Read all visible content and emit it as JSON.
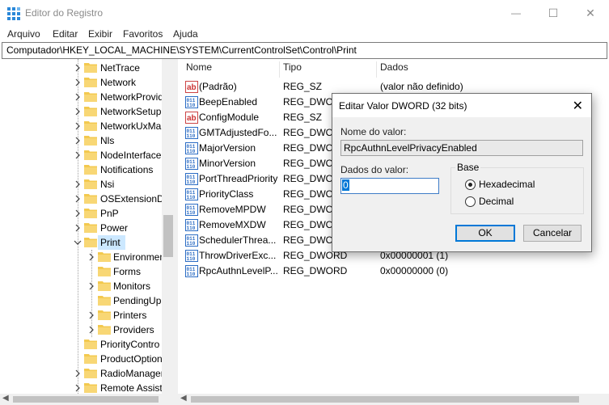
{
  "window": {
    "title": "Editor do Registro",
    "controls": {
      "minimize": "—",
      "maximize": "☐",
      "close": "✕"
    }
  },
  "menu": [
    "Arquivo",
    "Editar",
    "Exibir",
    "Favoritos",
    "Ajuda"
  ],
  "address": "Computador\\HKEY_LOCAL_MACHINE\\SYSTEM\\CurrentControlSet\\Control\\Print",
  "tree": {
    "items": [
      {
        "label": "NetTrace",
        "expandable": true,
        "selected": false
      },
      {
        "label": "Network",
        "expandable": true,
        "selected": false
      },
      {
        "label": "NetworkProvid",
        "expandable": true,
        "selected": false
      },
      {
        "label": "NetworkSetup",
        "expandable": true,
        "selected": false
      },
      {
        "label": "NetworkUxMa",
        "expandable": true,
        "selected": false
      },
      {
        "label": "Nls",
        "expandable": true,
        "selected": false
      },
      {
        "label": "NodeInterface",
        "expandable": true,
        "selected": false
      },
      {
        "label": "Notifications",
        "expandable": false,
        "selected": false
      },
      {
        "label": "Nsi",
        "expandable": true,
        "selected": false
      },
      {
        "label": "OSExtensionDa",
        "expandable": true,
        "selected": false
      },
      {
        "label": "PnP",
        "expandable": true,
        "selected": false
      },
      {
        "label": "Power",
        "expandable": true,
        "selected": false
      },
      {
        "label": "Print",
        "expandable": true,
        "expanded": true,
        "selected": true
      },
      {
        "label": "Environmen",
        "expandable": true,
        "selected": false,
        "child": true
      },
      {
        "label": "Forms",
        "expandable": false,
        "selected": false,
        "child": true
      },
      {
        "label": "Monitors",
        "expandable": true,
        "selected": false,
        "child": true
      },
      {
        "label": "PendingUp",
        "expandable": false,
        "selected": false,
        "child": true
      },
      {
        "label": "Printers",
        "expandable": true,
        "selected": false,
        "child": true
      },
      {
        "label": "Providers",
        "expandable": true,
        "selected": false,
        "child": true
      },
      {
        "label": "PriorityContro",
        "expandable": false,
        "selected": false
      },
      {
        "label": "ProductOption",
        "expandable": false,
        "selected": false
      },
      {
        "label": "RadioManager",
        "expandable": true,
        "selected": false
      },
      {
        "label": "Remote Assist",
        "expandable": true,
        "selected": false
      }
    ]
  },
  "list": {
    "headers": [
      "Nome",
      "Tipo",
      "Dados"
    ],
    "rows": [
      {
        "icon": "string",
        "name": "(Padrão)",
        "type": "REG_SZ",
        "data": "(valor não definido)"
      },
      {
        "icon": "binary",
        "name": "BeepEnabled",
        "type": "REG_DWORD",
        "data": ""
      },
      {
        "icon": "string",
        "name": "ConfigModule",
        "type": "REG_SZ",
        "data": ""
      },
      {
        "icon": "binary",
        "name": "GMTAdjustedFo...",
        "type": "REG_DWORD",
        "data": ""
      },
      {
        "icon": "binary",
        "name": "MajorVersion",
        "type": "REG_DWORD",
        "data": ""
      },
      {
        "icon": "binary",
        "name": "MinorVersion",
        "type": "REG_DWORD",
        "data": ""
      },
      {
        "icon": "binary",
        "name": "PortThreadPriority",
        "type": "REG_DWORD",
        "data": ""
      },
      {
        "icon": "binary",
        "name": "PriorityClass",
        "type": "REG_DWORD",
        "data": ""
      },
      {
        "icon": "binary",
        "name": "RemoveMPDW",
        "type": "REG_DWORD",
        "data": ""
      },
      {
        "icon": "binary",
        "name": "RemoveMXDW",
        "type": "REG_DWORD",
        "data": ""
      },
      {
        "icon": "binary",
        "name": "SchedulerThrea...",
        "type": "REG_DWORD",
        "data": ""
      },
      {
        "icon": "binary",
        "name": "ThrowDriverExc...",
        "type": "REG_DWORD",
        "data": "0x00000001 (1)"
      },
      {
        "icon": "binary",
        "name": "RpcAuthnLevelP...",
        "type": "REG_DWORD",
        "data": "0x00000000 (0)"
      }
    ]
  },
  "dialog": {
    "title": "Editar Valor DWORD (32 bits)",
    "close": "✕",
    "value_name_label": "Nome do valor:",
    "value_name": "RpcAuthnLevelPrivacyEnabled",
    "value_data_label": "Dados do valor:",
    "value_data": "0",
    "base_label": "Base",
    "base_options": [
      {
        "label": "Hexadecimal",
        "checked": true
      },
      {
        "label": "Decimal",
        "checked": false
      }
    ],
    "ok": "OK",
    "cancel": "Cancelar"
  },
  "colors": {
    "selection": "#cce8ff",
    "folder": "#f3c94f",
    "accent": "#0078d7"
  }
}
